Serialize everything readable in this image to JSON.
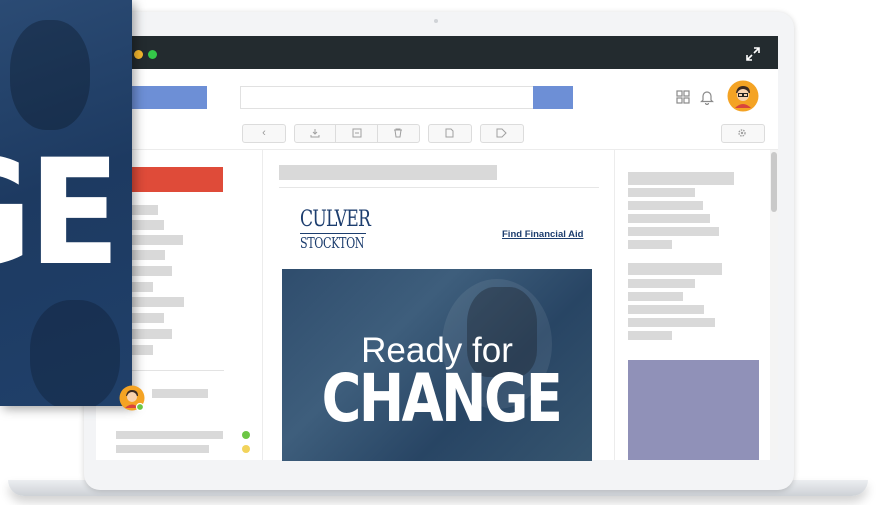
{
  "email": {
    "logo": {
      "line1": "CULVER",
      "line2": "STOCKTON"
    },
    "link": "Find Financial Aid",
    "hero": {
      "subtitle": "Ready for",
      "headline": "CHANGE"
    }
  },
  "overlay": {
    "text": "GE"
  },
  "icons": {
    "expand": "expand-icon",
    "apps": "apps-grid-icon",
    "bell": "bell-icon",
    "back": "back-icon",
    "download": "download-icon",
    "archive": "archive-icon",
    "trash": "trash-icon",
    "document": "document-icon",
    "tag": "tag-icon",
    "settings": "gear-icon"
  },
  "colors": {
    "titlebar": "#232b2f",
    "search_button": "#6d8fd6",
    "compose_button": "#df4b39",
    "ad_block": "#9091b8",
    "window_yellow": "#f5b82e",
    "window_green": "#34c749",
    "status_green": "#6cc644",
    "status_yellow": "#f2d35b"
  }
}
